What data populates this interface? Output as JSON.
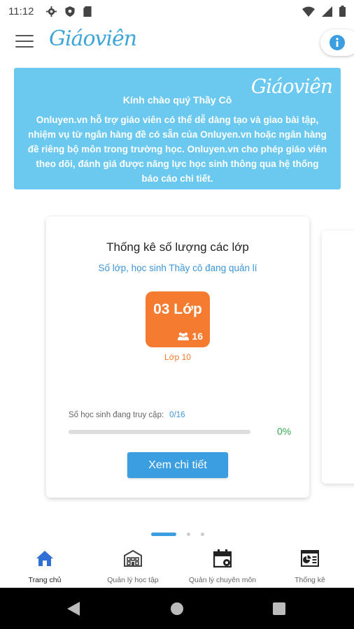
{
  "status_bar": {
    "time": "11:12"
  },
  "app_bar": {
    "logo": "Giáoviên"
  },
  "banner": {
    "logo": "Giáoviên",
    "greeting": "Kính chào quý Thầy Cô",
    "text": "Onluyen.vn hỗ trợ giáo viên có thể dễ dàng tạo và giao bài tập, nhiệm vụ từ ngân hàng đề có sẵn của Onluyen.vn hoặc ngân hàng đề riêng bộ môn trong trường học. Onluyen.vn cho phép giáo viên theo dõi, đánh giá được năng lực học sinh thông qua hệ thống báo cáo chi tiết."
  },
  "stats_card": {
    "title": "Thống kê số lượng các lớp",
    "subtitle": "Số lớp, học sinh Thầy cô đang quản lí",
    "class_count": "03 Lớp",
    "student_count": "16",
    "class_name": "Lớp 10",
    "access_label": "Số học sinh đang truy cập:",
    "access_value": "0/16",
    "progress_percent": "0%",
    "progress_fraction": 0,
    "detail_button": "Xem chi tiết"
  },
  "pager": {
    "count": 3,
    "active": 0
  },
  "bottom_nav": {
    "items": [
      {
        "label": "Trang chủ",
        "icon": "home-icon",
        "active": true
      },
      {
        "label": "Quản lý học tập",
        "icon": "school-icon",
        "active": false
      },
      {
        "label": "Quản lý chuyên môn",
        "icon": "calendar-icon",
        "active": false
      },
      {
        "label": "Thống kê",
        "icon": "report-icon",
        "active": false
      }
    ]
  },
  "colors": {
    "accent": "#3a9ee0",
    "banner": "#6bc9ef",
    "class_tile": "#f47b2f",
    "progress": "#34a853",
    "nav_active": "#2f6fd6"
  }
}
